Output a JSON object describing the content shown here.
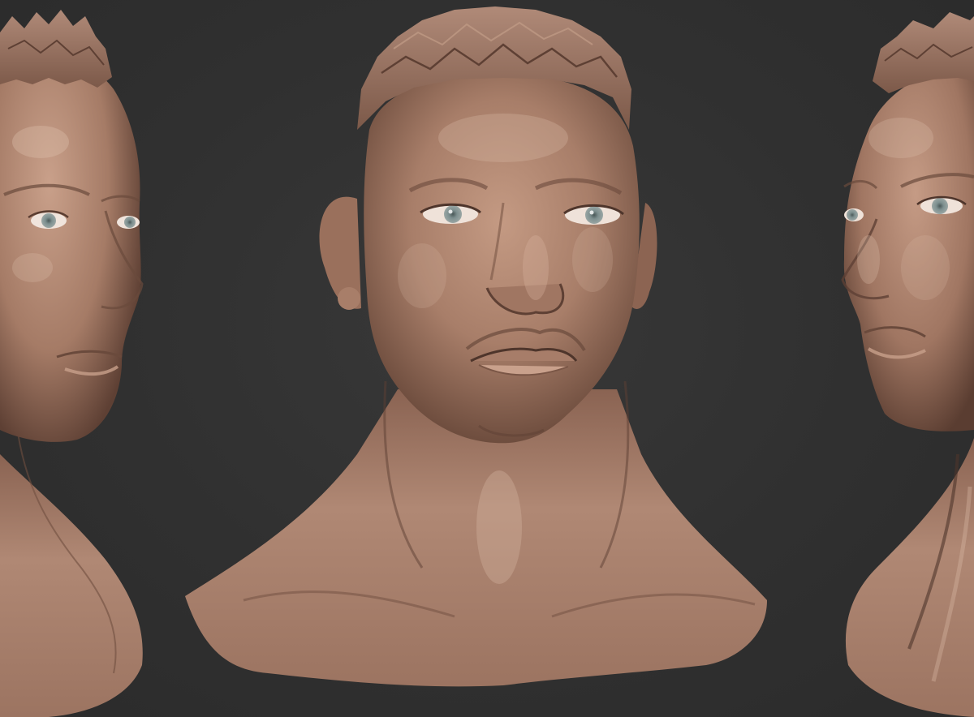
{
  "scene": {
    "background_color": "#303030",
    "material_color": "#a8806c",
    "iris_color": "#7d8f8f",
    "views": [
      {
        "name": "three-quarter-left"
      },
      {
        "name": "front"
      },
      {
        "name": "three-quarter-right"
      }
    ]
  }
}
